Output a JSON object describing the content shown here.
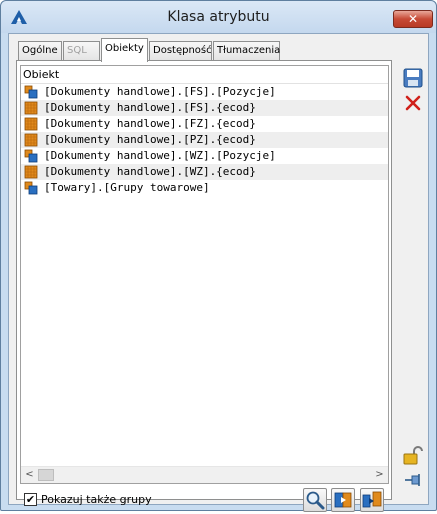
{
  "window": {
    "title": "Klasa atrybutu",
    "close_glyph": "✕"
  },
  "tabs": [
    {
      "label": "Ogólne",
      "state": "normal"
    },
    {
      "label": "SQL",
      "state": "disabled"
    },
    {
      "label": "Obiekty",
      "state": "active"
    },
    {
      "label": "Dostępność",
      "state": "normal"
    },
    {
      "label": "Tłumaczenia",
      "state": "normal"
    }
  ],
  "list": {
    "header": "Obiekt",
    "rows": [
      {
        "text": "[Dokumenty handlowe].[FS].[Pozycje]",
        "icon": "object-blue-icon"
      },
      {
        "text": "[Dokumenty handlowe].[FS].{ecod}",
        "icon": "object-orange-icon"
      },
      {
        "text": "[Dokumenty handlowe].[FZ].{ecod}",
        "icon": "object-orange-icon"
      },
      {
        "text": "[Dokumenty handlowe].[PZ].{ecod}",
        "icon": "object-orange-icon"
      },
      {
        "text": "[Dokumenty handlowe].[WZ].[Pozycje]",
        "icon": "object-blue-icon"
      },
      {
        "text": "[Dokumenty handlowe].[WZ].{ecod}",
        "icon": "object-orange-icon"
      },
      {
        "text": "[Towary].[Grupy towarowe]",
        "icon": "object-blue-icon"
      }
    ]
  },
  "scroll": {
    "left_glyph": "<",
    "right_glyph": ">"
  },
  "footer": {
    "checkbox_label": "Pokazuj także grupy",
    "checkbox_checked": "✔"
  },
  "colors": {
    "accent": "#1f5fa8",
    "delete": "#d0201a",
    "orange": "#e08a1c"
  }
}
